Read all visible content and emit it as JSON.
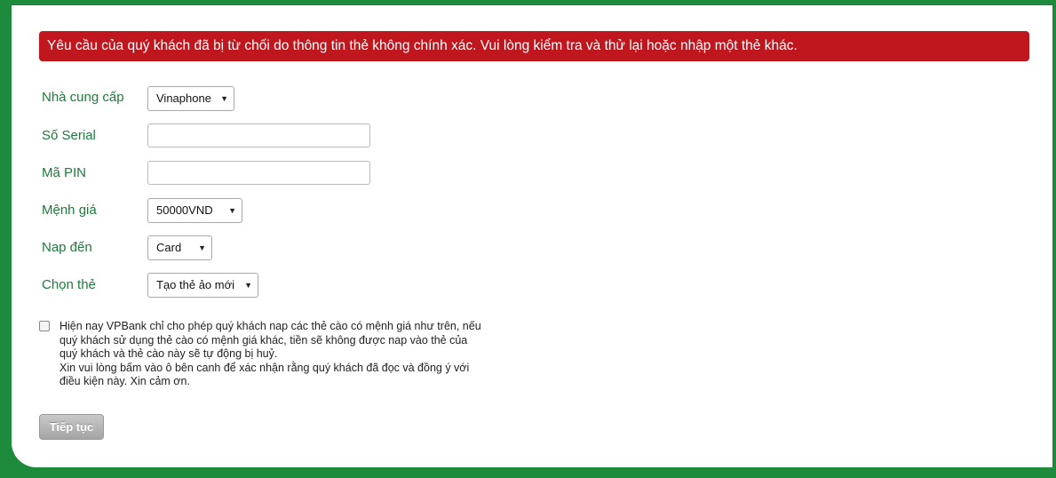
{
  "error_message": "Yêu cầu của quý khách đã bị từ chối do thông tin thẻ không chính xác. Vui lòng kiểm tra và thử lại hoặc nhập một thẻ khác.",
  "form": {
    "provider": {
      "label": "Nhà cung cấp",
      "value": "Vinaphone"
    },
    "serial": {
      "label": "Số Serial",
      "value": ""
    },
    "pin": {
      "label": "Mã PIN",
      "value": ""
    },
    "denomination": {
      "label": "Mệnh giá",
      "value": "50000VND"
    },
    "topup_to": {
      "label": "Nap đến",
      "value": "Card"
    },
    "choose_card": {
      "label": "Chọn thẻ",
      "value": "Tạo thẻ ảo mới"
    }
  },
  "agreement": {
    "checked": false,
    "lines": [
      "Hiện nay VPBank chỉ cho phép quý khách nap các thẻ cào có mệnh giá như trên, nếu",
      "quý khách sử dụng thẻ cào có mệnh giá khác, tiền sẽ không được nap vào thẻ của",
      "quý khách và thẻ cào này sẽ tự động bị huỷ.",
      "Xin vui lòng bấm vào ô bên canh để xác nhận rằng quý khách đã đọc và đồng ý với",
      "điều kiện này. Xin cảm ơn."
    ]
  },
  "continue_label": "Tiếp tục",
  "icons": {
    "dropdown": "triangle-down-icon"
  },
  "colors": {
    "frame": "#1e8a3c",
    "error": "#c0161e",
    "label": "#1e7a3a",
    "button": "#b0b0b0"
  }
}
